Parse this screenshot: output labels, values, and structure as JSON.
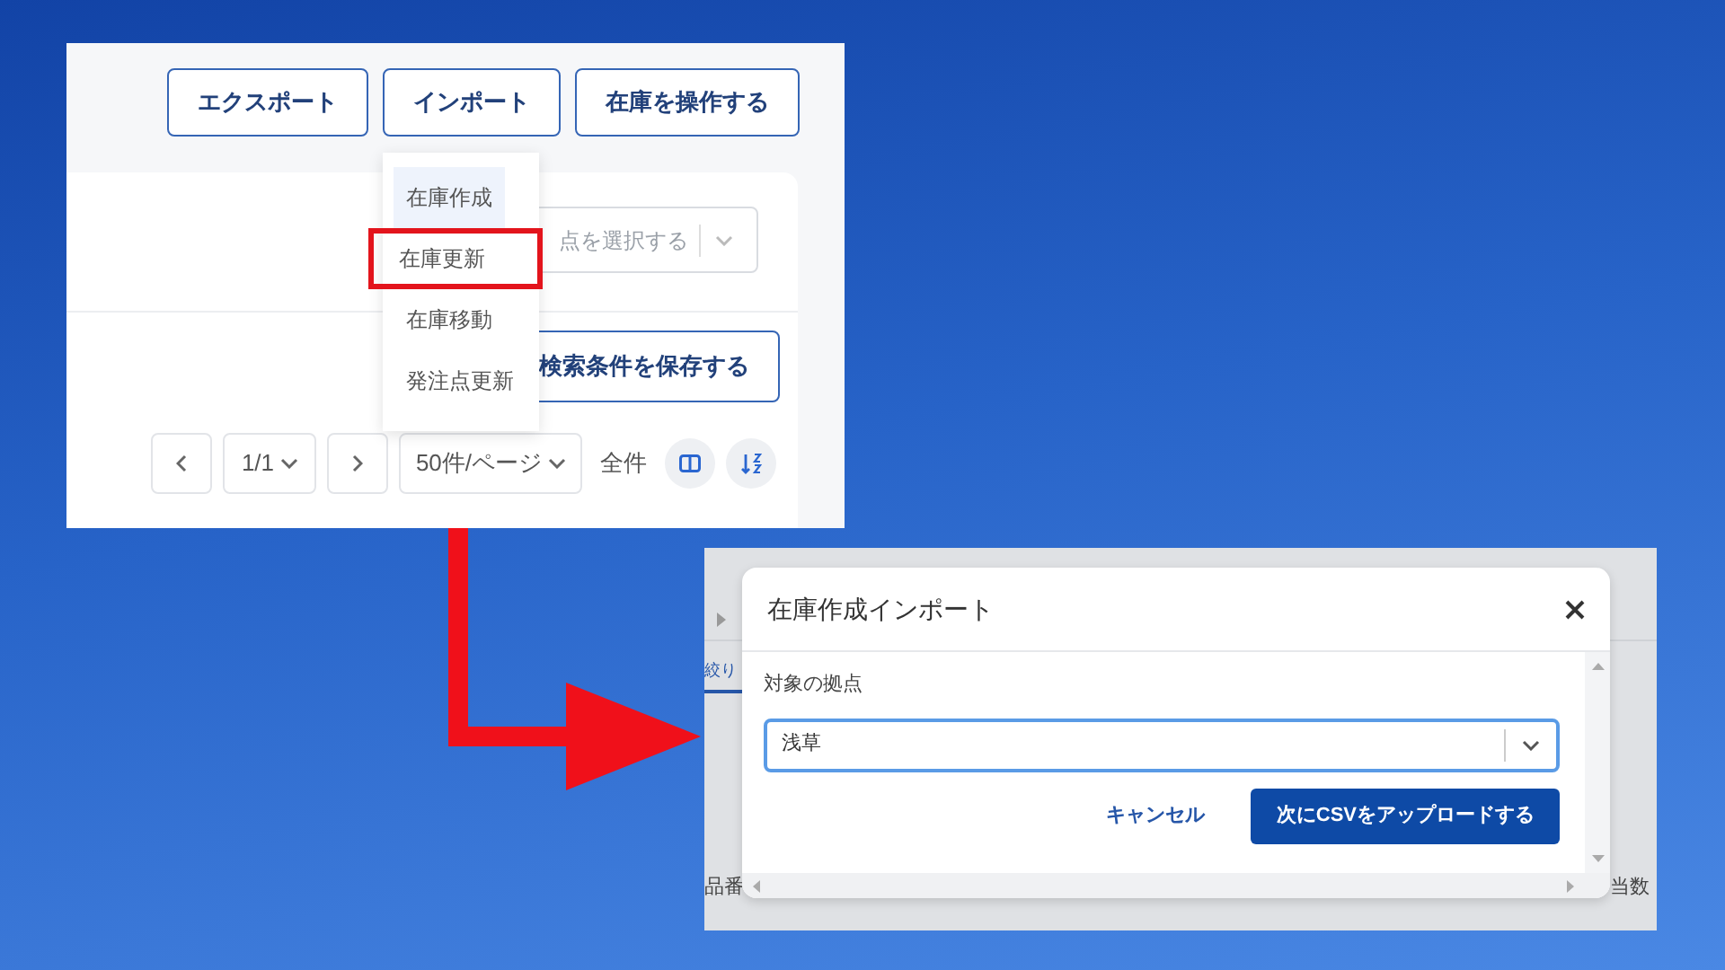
{
  "top_screenshot": {
    "action_buttons": [
      "エクスポート",
      "インポート",
      "在庫を操作する"
    ],
    "import_menu": [
      {
        "label": "在庫作成",
        "hovered": true,
        "callout": false
      },
      {
        "label": "在庫更新",
        "hovered": false,
        "callout": true
      },
      {
        "label": "在庫移動",
        "hovered": false,
        "callout": false
      },
      {
        "label": "発注点更新",
        "hovered": false,
        "callout": false
      }
    ],
    "location_select": {
      "placeholder": "点を選択する"
    },
    "save_search_button": "検索条件を保存する",
    "pagination": {
      "page": "1/1",
      "per_page": "50件/ページ",
      "total_label": "全件"
    }
  },
  "bottom_screenshot": {
    "filter_tab": "絞り",
    "column_headers": [
      "品番",
      "当数"
    ],
    "modal": {
      "title": "在庫作成インポート",
      "field_label": "対象の拠点",
      "selected_location": "浅草",
      "cancel_button": "キャンセル",
      "submit_button": "次にCSVをアップロードする"
    }
  }
}
